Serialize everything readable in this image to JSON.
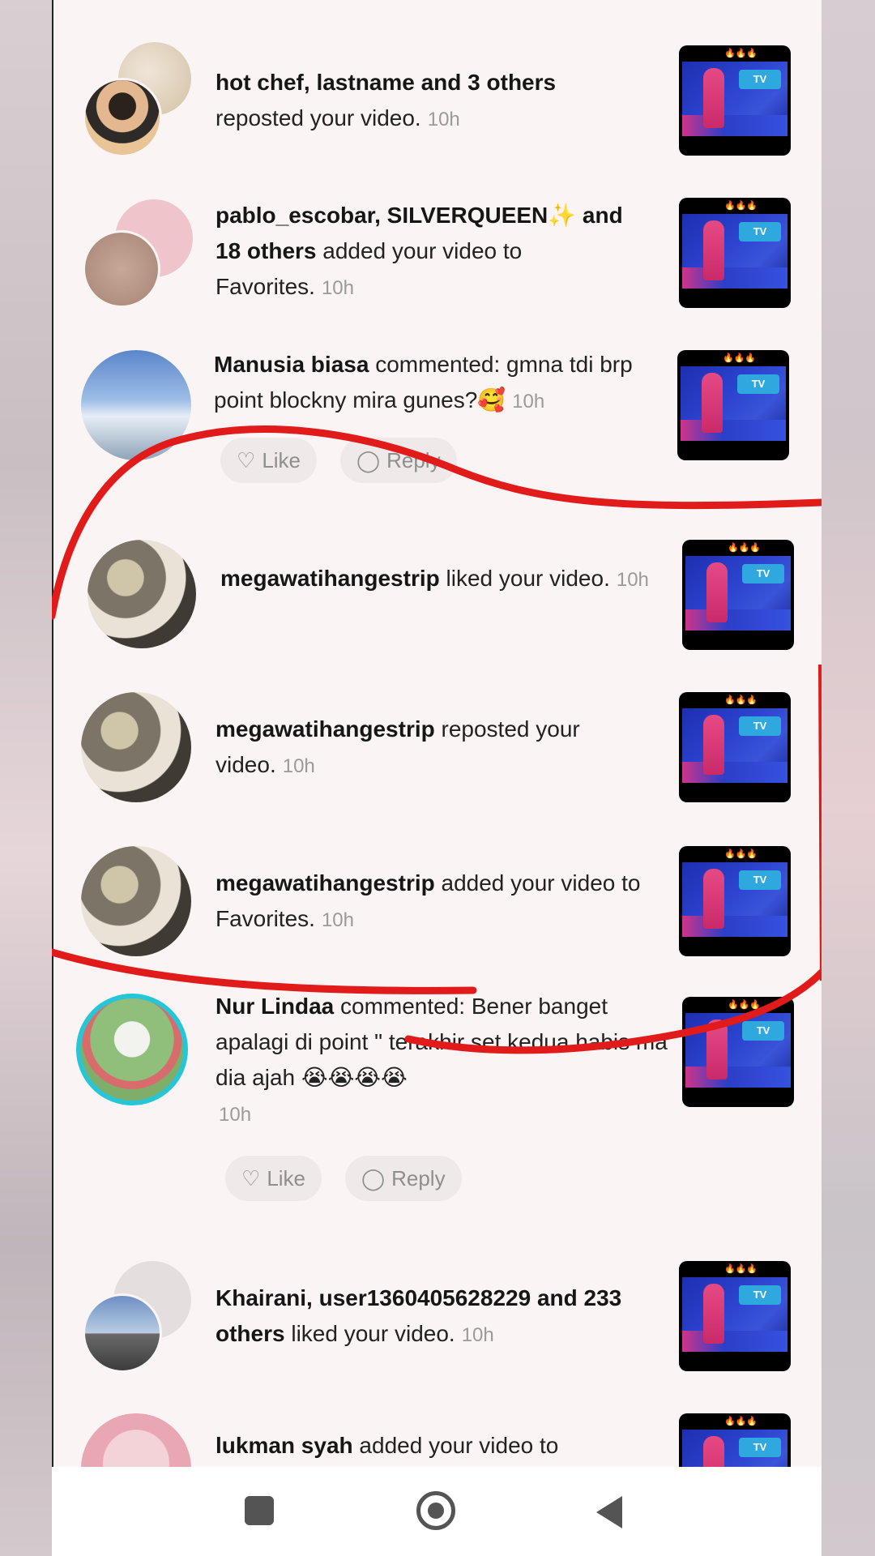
{
  "notifications": [
    {
      "name": "hot chef, lastname and 3 others",
      "action": "reposted your video.",
      "time": "10h"
    },
    {
      "name": "pablo_escobar, SILVERQUEEN✨ and 18 others",
      "action": "added your video to Favorites.",
      "time": "10h"
    },
    {
      "name": "Manusia biasa",
      "action": "commented: gmna tdi brp point blockny mira gunes?🥰",
      "time": "10h",
      "like_label": "Like",
      "reply_label": "Reply"
    },
    {
      "name": "megawatihangestrip",
      "action": "liked your video.",
      "time": "10h"
    },
    {
      "name": "megawatihangestrip",
      "action": "reposted your video.",
      "time": "10h"
    },
    {
      "name": "megawatihangestrip",
      "action": "added your video to Favorites.",
      "time": "10h"
    },
    {
      "name": "Nur Lindaa",
      "action": "commented: Bener banget apalagi di point \" terakhir set kedua habis ma dia ajah 😭😭😭😭",
      "time": "10h",
      "like_label": "Like",
      "reply_label": "Reply"
    },
    {
      "name": "Khairani, user1360405628229 and 233 others",
      "action": "liked your video.",
      "time": "10h"
    },
    {
      "name": "lukman syah",
      "action": "added your video to",
      "time": ""
    }
  ],
  "thumbnail": {
    "tag": "🔥🔥🔥",
    "logo": "TV"
  },
  "icons": {
    "like": "heart-icon",
    "reply": "comment-icon"
  },
  "nav": {
    "recents": "square-icon",
    "home": "circle-icon",
    "back": "triangle-back-icon"
  },
  "colors": {
    "annotation": "#e11a1a",
    "story_ring": "#27c6d6"
  }
}
